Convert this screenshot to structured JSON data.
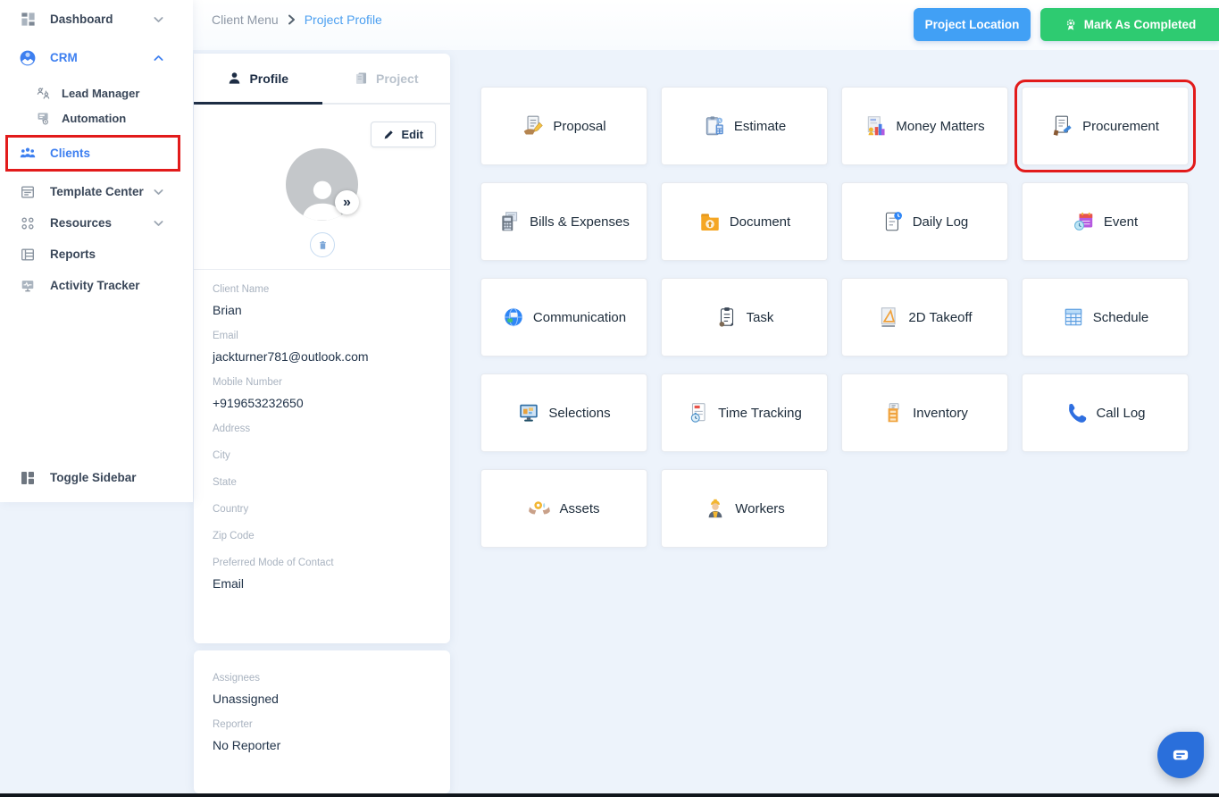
{
  "header": {
    "breadcrumb": [
      {
        "label": "Client Menu"
      },
      {
        "label": "Project Profile",
        "active": true
      }
    ],
    "buttons": [
      {
        "label": "Project Location",
        "color": "#41a0f5"
      },
      {
        "label": "Mark As Completed",
        "color": "#2ecb71",
        "icon": "medal-icon"
      }
    ]
  },
  "sidebar": {
    "items": [
      {
        "label": "Dashboard",
        "icon": "dashboard-icon",
        "chevron": "down",
        "gap_after": true
      },
      {
        "label": "CRM",
        "icon": "crm-icon",
        "chevron": "up",
        "active": true,
        "gap_after": true
      },
      {
        "label": "Lead Manager",
        "icon": "lead-manager-icon",
        "indent": true
      },
      {
        "label": "Automation",
        "icon": "automation-icon",
        "indent": true
      },
      {
        "label": "Clients",
        "icon": "clients-icon",
        "active": true,
        "annotated": true,
        "gap_before": true,
        "gap_after": true
      },
      {
        "label": "Template Center",
        "icon": "template-center-icon",
        "chevron": "down"
      },
      {
        "label": "Resources",
        "icon": "resources-icon",
        "chevron": "down"
      },
      {
        "label": "Reports",
        "icon": "reports-icon"
      },
      {
        "label": "Activity Tracker",
        "icon": "activity-tracker-icon"
      }
    ],
    "footer": {
      "label": "Toggle Sidebar",
      "icon": "toggle-sidebar-icon"
    }
  },
  "profile_panel": {
    "tabs": [
      {
        "label": "Profile",
        "icon": "person-icon",
        "active": true
      },
      {
        "label": "Project",
        "icon": "project-doc-icon",
        "active": false
      }
    ],
    "edit_label": "Edit",
    "avatar_badge": "»",
    "fields": [
      {
        "label": "Client Name",
        "value": "Brian"
      },
      {
        "label": "Email",
        "value": "jackturner781@outlook.com"
      },
      {
        "label": "Mobile Number",
        "value": "+919653232650"
      },
      {
        "label": "Address",
        "value": ""
      },
      {
        "label": "City",
        "value": ""
      },
      {
        "label": "State",
        "value": ""
      },
      {
        "label": "Country",
        "value": ""
      },
      {
        "label": "Zip Code",
        "value": ""
      },
      {
        "label": "Preferred Mode of Contact",
        "value": "Email"
      }
    ]
  },
  "assignment_panel": {
    "fields": [
      {
        "label": "Assignees",
        "value": "Unassigned"
      },
      {
        "label": "Reporter",
        "value": "No Reporter"
      }
    ]
  },
  "modules": {
    "tiles": [
      {
        "label": "Proposal",
        "icon": "proposal-icon"
      },
      {
        "label": "Estimate",
        "icon": "estimate-icon"
      },
      {
        "label": "Money Matters",
        "icon": "money-matters-icon"
      },
      {
        "label": "Procurement",
        "icon": "procurement-icon",
        "highlighted": true
      },
      {
        "label": "Bills & Expenses",
        "icon": "bills-expenses-icon"
      },
      {
        "label": "Document",
        "icon": "document-icon"
      },
      {
        "label": "Daily Log",
        "icon": "daily-log-icon"
      },
      {
        "label": "Event",
        "icon": "event-icon"
      },
      {
        "label": "Communication",
        "icon": "communication-icon"
      },
      {
        "label": "Task",
        "icon": "task-icon"
      },
      {
        "label": "2D Takeoff",
        "icon": "takeoff-2d-icon"
      },
      {
        "label": "Schedule",
        "icon": "schedule-icon"
      },
      {
        "label": "Selections",
        "icon": "selections-icon"
      },
      {
        "label": "Time Tracking",
        "icon": "time-tracking-icon"
      },
      {
        "label": "Inventory",
        "icon": "inventory-icon"
      },
      {
        "label": "Call Log",
        "icon": "call-log-icon"
      },
      {
        "label": "Assets",
        "icon": "assets-icon"
      },
      {
        "label": "Workers",
        "icon": "workers-icon"
      }
    ]
  },
  "colors": {
    "accent_blue": "#3d7ff0",
    "breadcrumb_blue": "#4b9ff0",
    "button_blue": "#41a0f5",
    "button_green": "#2ecb71",
    "annotation_red": "#e21b1b",
    "dark_navy": "#1d2d44",
    "background": "#edf3fb"
  }
}
